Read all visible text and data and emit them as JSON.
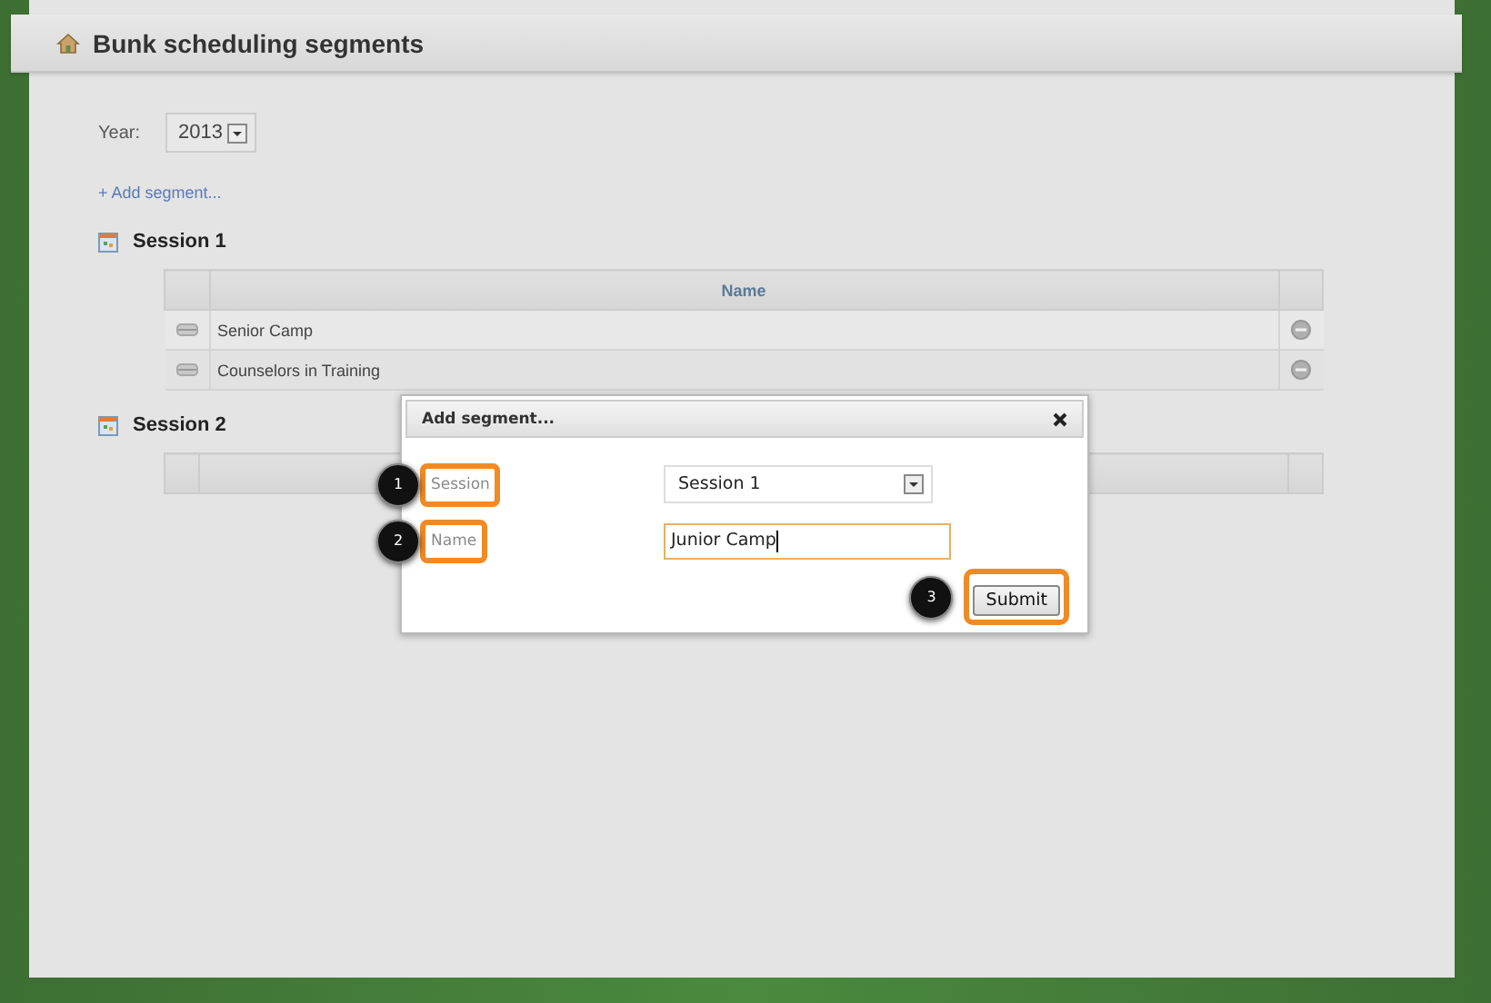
{
  "header": {
    "title": "Bunk scheduling segments"
  },
  "year": {
    "label": "Year:",
    "value": "2013"
  },
  "add_link": "+ Add segment...",
  "sessions": [
    {
      "title": "Session 1",
      "columns": [
        "Name"
      ],
      "rows": [
        {
          "name": "Senior Camp"
        },
        {
          "name": "Counselors in Training"
        }
      ]
    },
    {
      "title": "Session 2"
    }
  ],
  "dialog": {
    "title": "Add segment...",
    "fields": [
      {
        "label": "Session",
        "kind": "select",
        "value": "Session 1",
        "callout": "1"
      },
      {
        "label": "Name",
        "kind": "text",
        "value": "Junior Camp",
        "callout": "2"
      }
    ],
    "submit": {
      "label": "Submit",
      "callout": "3"
    }
  }
}
